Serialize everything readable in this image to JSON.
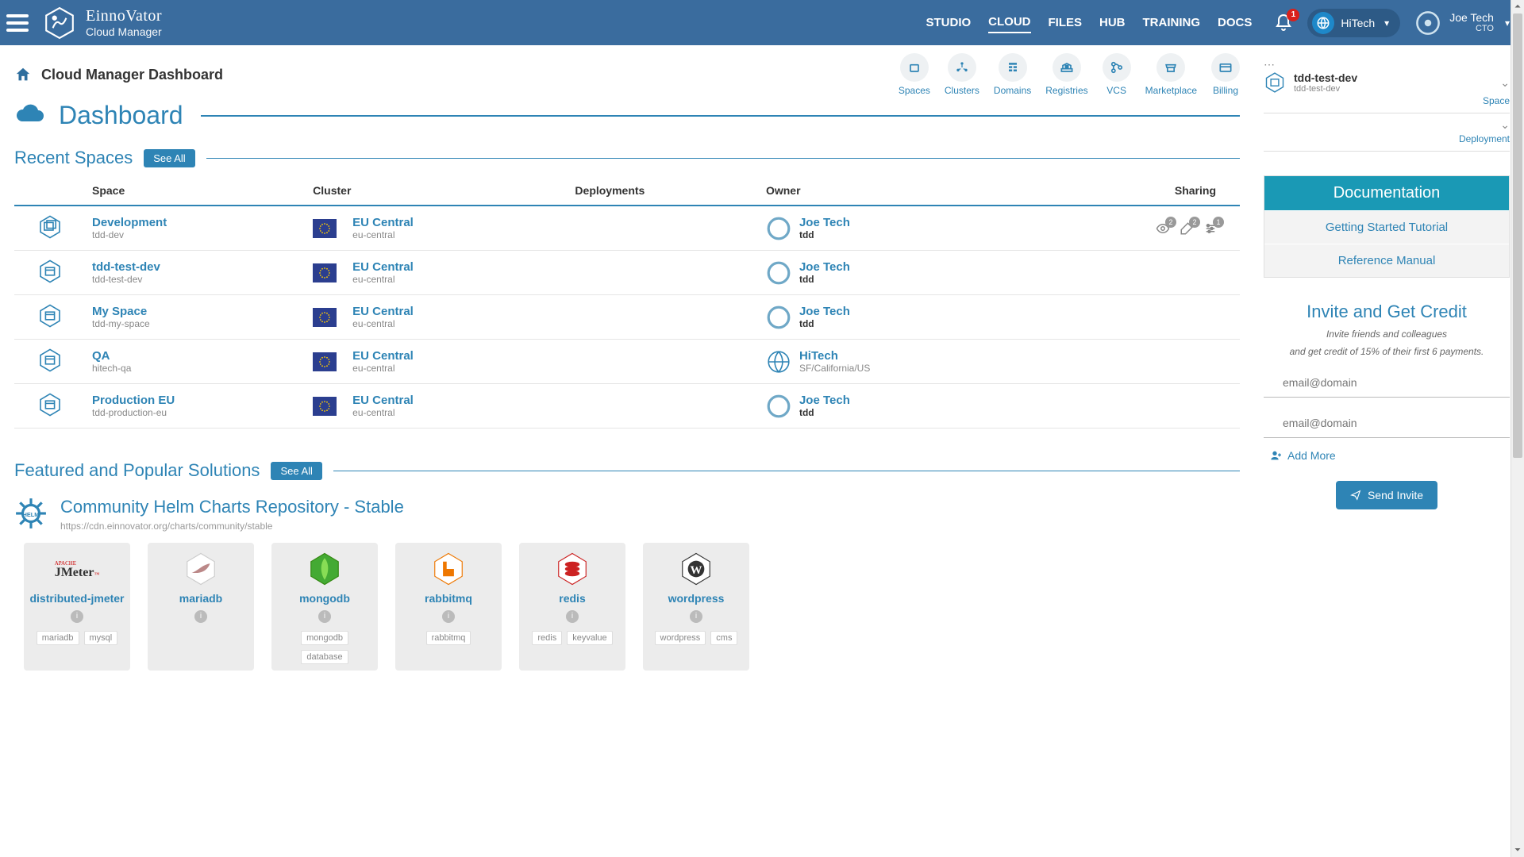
{
  "brand": {
    "name": "EinnoVator",
    "sub": "Cloud Manager"
  },
  "nav": {
    "items": [
      "STUDIO",
      "CLOUD",
      "FILES",
      "HUB",
      "TRAINING",
      "DOCS"
    ],
    "active": "CLOUD"
  },
  "notif_count": "1",
  "org": {
    "name": "HiTech"
  },
  "user": {
    "name": "Joe Tech",
    "role": "CTO"
  },
  "breadcrumb": "Cloud Manager Dashboard",
  "page_title": "Dashboard",
  "iconbar": [
    {
      "label": "Spaces"
    },
    {
      "label": "Clusters"
    },
    {
      "label": "Domains"
    },
    {
      "label": "Registries"
    },
    {
      "label": "VCS"
    },
    {
      "label": "Marketplace"
    },
    {
      "label": "Billing"
    }
  ],
  "recent": {
    "title": "Recent Spaces",
    "see_all": "See All",
    "cols": {
      "space": "Space",
      "cluster": "Cluster",
      "deploy": "Deployments",
      "owner": "Owner",
      "sharing": "Sharing"
    },
    "rows": [
      {
        "name": "Development",
        "slug": "tdd-dev",
        "cluster": "EU Central",
        "cslug": "eu-central",
        "owner": "Joe Tech",
        "oslug": "tdd",
        "otype": "user",
        "share": [
          2,
          2,
          1
        ]
      },
      {
        "name": "tdd-test-dev",
        "slug": "tdd-test-dev",
        "cluster": "EU Central",
        "cslug": "eu-central",
        "owner": "Joe Tech",
        "oslug": "tdd",
        "otype": "user"
      },
      {
        "name": "My Space",
        "slug": "tdd-my-space",
        "cluster": "EU Central",
        "cslug": "eu-central",
        "owner": "Joe Tech",
        "oslug": "tdd",
        "otype": "user"
      },
      {
        "name": "QA",
        "slug": "hitech-qa",
        "cluster": "EU Central",
        "cslug": "eu-central",
        "owner": "HiTech",
        "oslug": "SF/California/US",
        "otype": "org"
      },
      {
        "name": "Production EU",
        "slug": "tdd-production-eu",
        "cluster": "EU Central",
        "cslug": "eu-central",
        "owner": "Joe Tech",
        "oslug": "tdd",
        "otype": "user"
      }
    ]
  },
  "solutions": {
    "title": "Featured and Popular Solutions",
    "see_all": "See All",
    "repo_title": "Community Helm Charts Repository - Stable",
    "repo_url": "https://cdn.einnovator.org/charts/community/stable",
    "cards": [
      {
        "name": "distributed-jmeter",
        "tags": [
          "mariadb",
          "mysql"
        ],
        "logo": "jmeter"
      },
      {
        "name": "mariadb",
        "tags": [],
        "logo": "mariadb"
      },
      {
        "name": "mongodb",
        "tags": [
          "mongodb",
          "database"
        ],
        "logo": "mongodb"
      },
      {
        "name": "rabbitmq",
        "tags": [
          "rabbitmq"
        ],
        "logo": "rabbitmq"
      },
      {
        "name": "redis",
        "tags": [
          "redis",
          "keyvalue"
        ],
        "logo": "redis"
      },
      {
        "name": "wordpress",
        "tags": [
          "wordpress",
          "cms"
        ],
        "logo": "wordpress"
      }
    ]
  },
  "side_space": {
    "name": "tdd-test-dev",
    "slug": "tdd-test-dev",
    "label_space": "Space",
    "label_deploy": "Deployment"
  },
  "docs": {
    "title": "Documentation",
    "links": [
      "Getting Started Tutorial",
      "Reference Manual"
    ]
  },
  "invite": {
    "title": "Invite and Get Credit",
    "line1": "Invite friends and colleagues",
    "line2": "and get credit of 15% of their first 6 payments.",
    "placeholder": "email@domain",
    "add_more": "Add More",
    "send": "Send Invite"
  }
}
